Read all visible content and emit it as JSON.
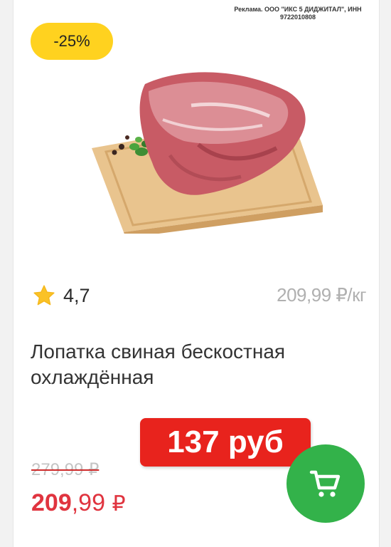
{
  "ad": {
    "text": "Реклама. ООО \"ИКС 5 ДИДЖИТАЛ\", ИНН 9722010808"
  },
  "badge": {
    "discount": "-25%",
    "color": "#ffd21f"
  },
  "product": {
    "image_icon": "pork-shoulder-on-board-image",
    "rating": "4,7",
    "unit_price": "209,99 ₽/кг",
    "title": "Лопатка свиная бескостная охлаждённая"
  },
  "price": {
    "sticker": "137 руб",
    "old": "279,99 ₽",
    "new_rub": "209",
    "new_kop": ",99",
    "currency": "₽",
    "accent_color": "#e0343f"
  },
  "cart": {
    "icon": "cart-icon",
    "color": "#33b24a"
  }
}
